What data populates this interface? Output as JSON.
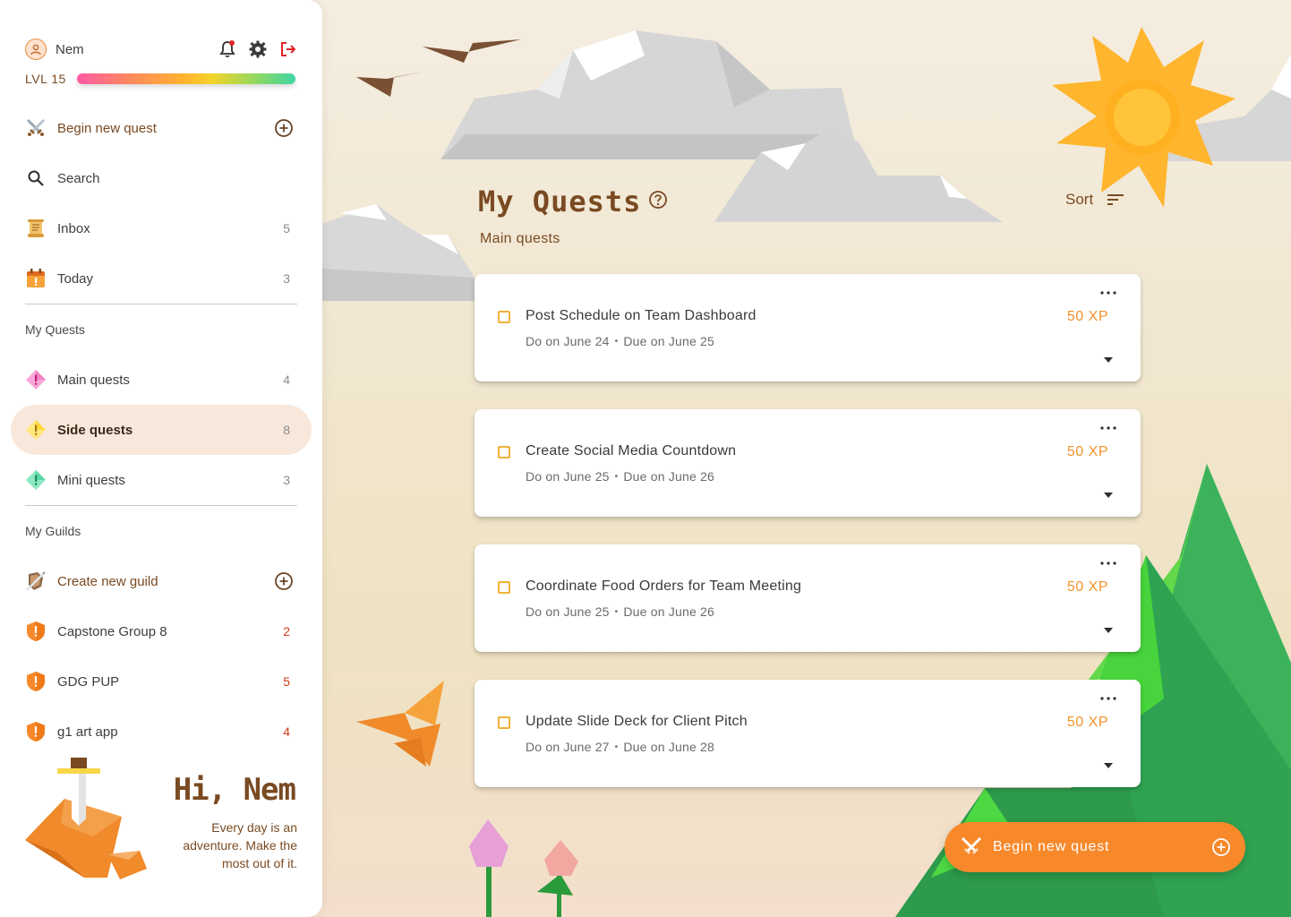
{
  "user": {
    "name": "Nem",
    "level_label": "LVL 15",
    "level_progress": 1.0
  },
  "nav": {
    "begin_quest": "Begin new quest",
    "search": "Search",
    "inbox": {
      "label": "Inbox",
      "count": "5"
    },
    "today": {
      "label": "Today",
      "count": "3"
    }
  },
  "quests_section": {
    "title": "My Quests",
    "items": [
      {
        "label": "Main quests",
        "count": "4"
      },
      {
        "label": "Side quests",
        "count": "8"
      },
      {
        "label": "Mini quests",
        "count": "3"
      }
    ]
  },
  "guilds_section": {
    "title": "My Guilds",
    "create": "Create new guild",
    "items": [
      {
        "label": "Capstone Group 8",
        "count": "2"
      },
      {
        "label": "GDG PUP",
        "count": "5"
      },
      {
        "label": "g1 art app",
        "count": "4"
      }
    ]
  },
  "greeting": {
    "title": "Hi, Nem",
    "text": "Every day is an adventure. Make the most out of it."
  },
  "main": {
    "title": "My Quests",
    "sort_label": "Sort",
    "section_label": "Main quests",
    "quests": [
      {
        "title": "Post Schedule on Team Dashboard",
        "do_on": "Do on June 24",
        "due_on": "Due on June 25",
        "xp": "50 XP"
      },
      {
        "title": "Create Social Media Countdown",
        "do_on": "Do on June 25",
        "due_on": "Due on June 26",
        "xp": "50 XP"
      },
      {
        "title": "Coordinate Food Orders for Team Meeting",
        "do_on": "Do on June 25",
        "due_on": "Due on June 26",
        "xp": "50 XP"
      },
      {
        "title": "Update Slide Deck for Client Pitch",
        "do_on": "Do on June 27",
        "due_on": "Due on June 28",
        "xp": "50 XP"
      }
    ],
    "date_separator": "•",
    "fab_label": "Begin new quest"
  },
  "colors": {
    "accent_orange": "#f7892b",
    "brown_text": "#7a4a22",
    "xp_orange": "#f0932b",
    "guild_count_red": "#d23a1f",
    "active_bg": "#f8e8dc"
  },
  "icons": {
    "profile": "person-icon",
    "notifications": "bell-icon",
    "settings": "gear-icon",
    "logout": "logout-icon",
    "begin_quest": "crossed-swords-icon",
    "search": "search-icon",
    "inbox": "scroll-icon",
    "today": "calendar-icon",
    "main_quests": "pink-diamond-icon",
    "side_quests": "yellow-diamond-icon",
    "mini_quests": "green-diamond-icon",
    "create_guild": "shield-sword-icon",
    "guild": "orange-shield-icon",
    "add": "plus-circle-icon",
    "help": "help-circle-icon",
    "sort": "sort-lines-icon",
    "more": "more-dots-icon",
    "expand": "caret-down-icon"
  }
}
